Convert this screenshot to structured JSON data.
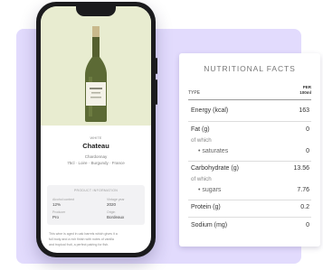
{
  "wine": {
    "eyebrow": "WHITE",
    "name": "Chateau",
    "line1": "Chardonnay",
    "line2": "75cl · Loire · Burgundy · France",
    "info_title": "PRODUCT INFORMATION",
    "fields": [
      {
        "label": "Alcohol content",
        "value": "12%"
      },
      {
        "label": "Vintage year",
        "value": "2020"
      },
      {
        "label": "Producer",
        "value": "Pro"
      },
      {
        "label": "Origin",
        "value": "Bordeaux"
      }
    ],
    "description": [
      "This wine is aged in oak barrels which gives it a",
      "full body and a rich finish with notes of vanilla",
      "and tropical fruit, a perfect pairing for fish."
    ]
  },
  "nutrition": {
    "title": "NUTRITIONAL FACTS",
    "type_label": "TYPE",
    "per_label_1": "PER",
    "per_label_2": "100ml",
    "rows": {
      "energy": {
        "label": "Energy (kcal)",
        "value": "163"
      },
      "fat": {
        "label": "Fat (g)",
        "value": "0"
      },
      "fat_sub": "of which",
      "saturates": {
        "label": "saturates",
        "value": "0"
      },
      "carbs": {
        "label": "Carbohydrate (g)",
        "value": "13.56"
      },
      "carbs_sub": "of which",
      "sugars": {
        "label": "sugars",
        "value": "7.76"
      },
      "protein": {
        "label": "Protein (g)",
        "value": "0.2"
      },
      "sodium": {
        "label": "Sodium (mg)",
        "value": "0"
      }
    }
  },
  "colors": {
    "background_panel": "#e2dbfd",
    "phone_hero": "#e8ecd0",
    "phone_frame": "#1b1b1d"
  }
}
